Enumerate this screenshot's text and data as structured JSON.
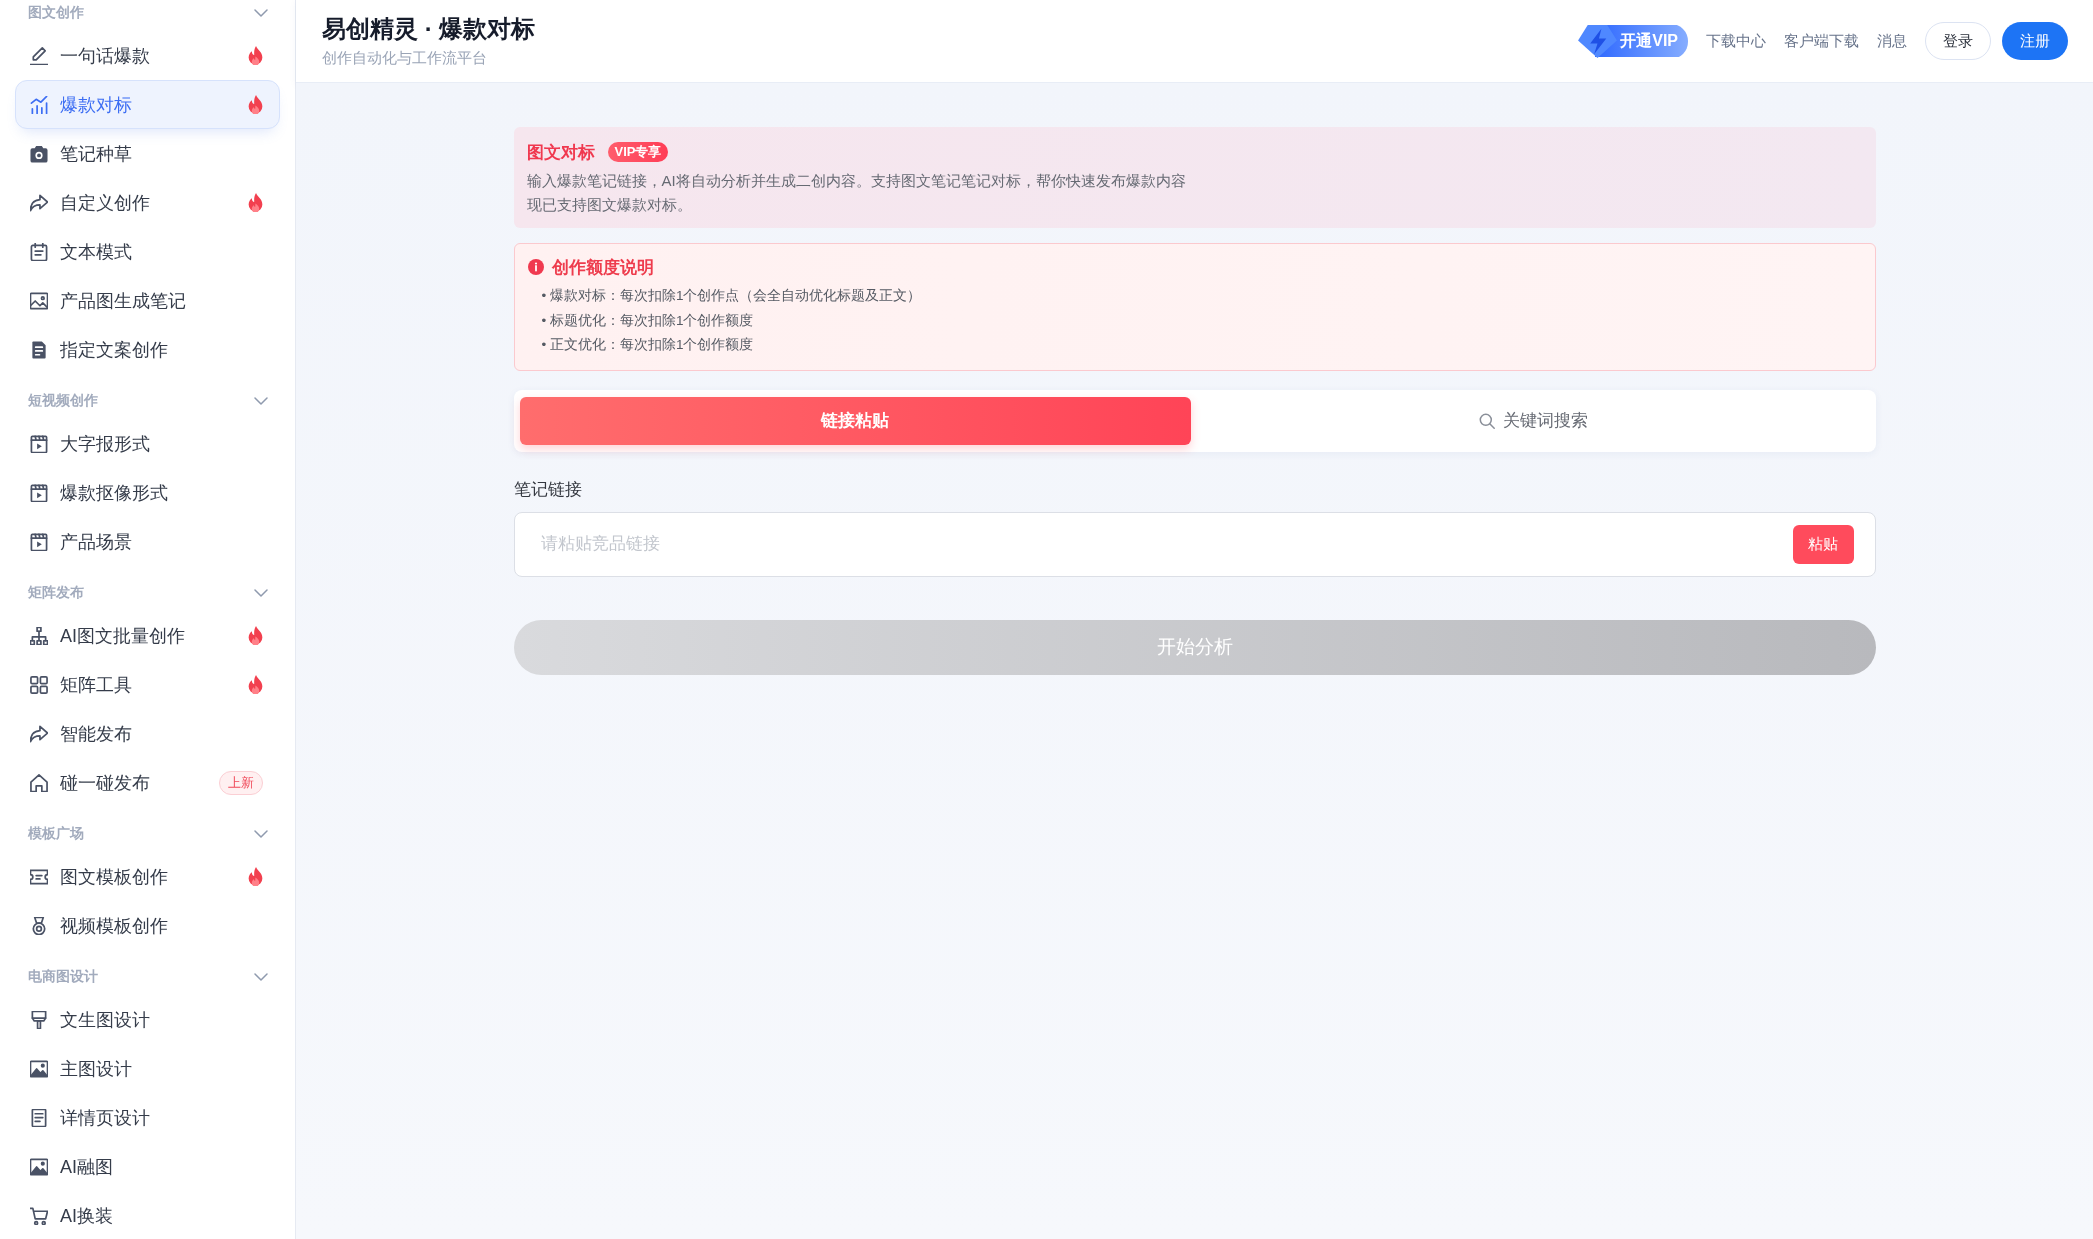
{
  "sidebar": {
    "groups": [
      {
        "title": "图文创作",
        "expanded": true,
        "items": [
          {
            "label": "一句话爆款",
            "hot": true,
            "selected": false
          },
          {
            "label": "爆款对标",
            "hot": true,
            "selected": true
          },
          {
            "label": "笔记种草",
            "hot": false,
            "selected": false
          },
          {
            "label": "自定义创作",
            "hot": true,
            "selected": false
          },
          {
            "label": "文本模式",
            "hot": false,
            "selected": false
          },
          {
            "label": "产品图生成笔记",
            "hot": false,
            "selected": false
          },
          {
            "label": "指定文案创作",
            "hot": false,
            "selected": false
          }
        ]
      },
      {
        "title": "短视频创作",
        "expanded": true,
        "items": [
          {
            "label": "大字报形式",
            "hot": false,
            "selected": false
          },
          {
            "label": "爆款抠像形式",
            "hot": false,
            "selected": false
          },
          {
            "label": "产品场景",
            "hot": false,
            "selected": false
          }
        ]
      },
      {
        "title": "矩阵发布",
        "expanded": true,
        "items": [
          {
            "label": "AI图文批量创作",
            "hot": true,
            "selected": false
          },
          {
            "label": "矩阵工具",
            "hot": true,
            "selected": false
          },
          {
            "label": "智能发布",
            "hot": false,
            "selected": false
          },
          {
            "label": "碰一碰发布",
            "hot": false,
            "selected": false,
            "badge": "上新"
          }
        ]
      },
      {
        "title": "模板广场",
        "expanded": true,
        "items": [
          {
            "label": "图文模板创作",
            "hot": true,
            "selected": false
          },
          {
            "label": "视频模板创作",
            "hot": false,
            "selected": false
          }
        ]
      },
      {
        "title": "电商图设计",
        "expanded": true,
        "items": [
          {
            "label": "文生图设计",
            "hot": false,
            "selected": false
          },
          {
            "label": "主图设计",
            "hot": false,
            "selected": false
          },
          {
            "label": "详情页设计",
            "hot": false,
            "selected": false
          },
          {
            "label": "AI融图",
            "hot": false,
            "selected": false
          },
          {
            "label": "AI换装",
            "hot": false,
            "selected": false
          }
        ]
      }
    ]
  },
  "header": {
    "title": "易创精灵 · 爆款对标",
    "subtitle": "创作自动化与工作流平台",
    "vip_button": "开通VIP",
    "links": [
      "下载中心",
      "客户端下载",
      "消息"
    ],
    "login_button": "登录",
    "register_button": "注册"
  },
  "intro": {
    "title": "图文对标",
    "badge": "VIP专享",
    "description": [
      "输入爆款笔记链接，AI将自动分析并生成二创内容。支持图文笔记笔记对标，帮你快速发布爆款内容",
      "现已支持图文爆款对标。"
    ]
  },
  "quota": {
    "title": "创作额度说明",
    "rules": [
      "• 爆款对标：每次扣除1个创作点（会全自动优化标题及正文）",
      "• 标题优化：每次扣除1个创作额度",
      "• 正文优化：每次扣除1个创作额度"
    ]
  },
  "tabs": [
    {
      "label": "链接粘贴",
      "selected": true
    },
    {
      "label": "关键词搜索",
      "selected": false
    }
  ],
  "form": {
    "label": "笔记链接",
    "placeholder": "请粘贴竞品链接",
    "paste_button": "粘贴"
  },
  "submit": {
    "label": "开始分析",
    "disabled": true
  }
}
